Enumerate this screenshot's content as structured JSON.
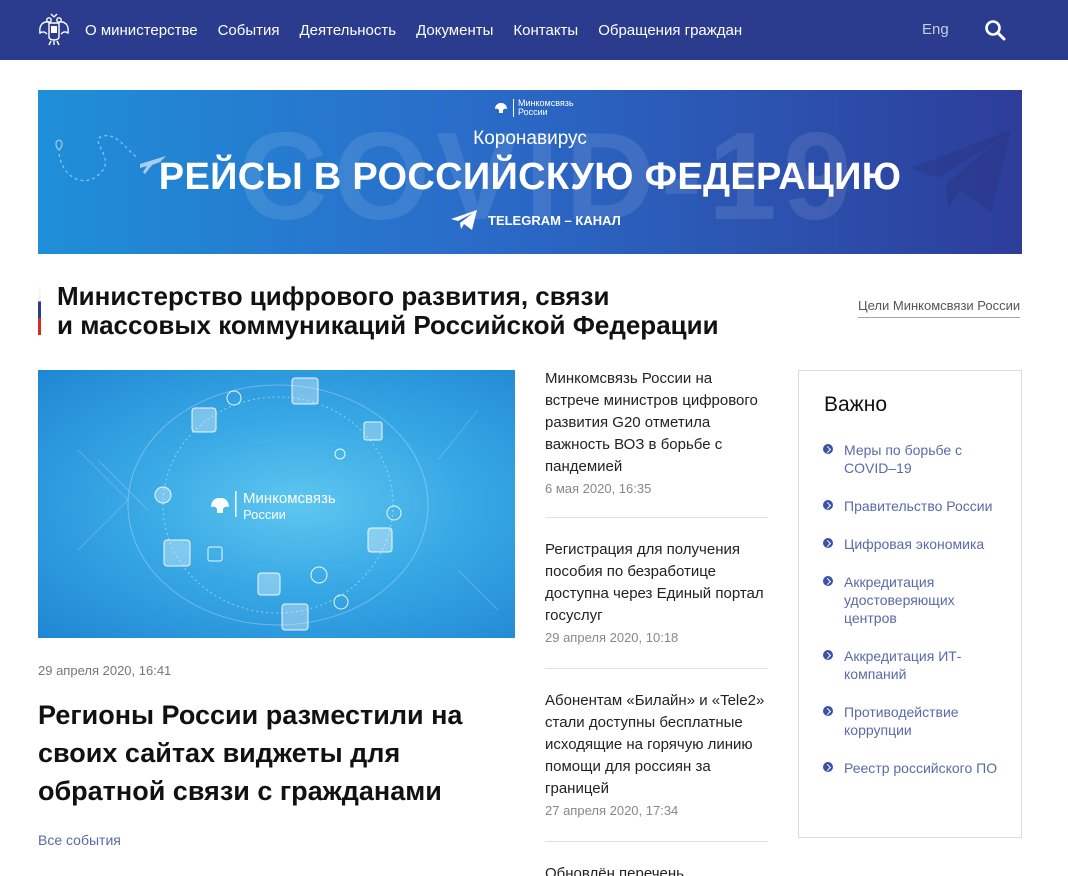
{
  "nav": {
    "items": [
      "О министерстве",
      "События",
      "Деятельность",
      "Документы",
      "Контакты",
      "Обращения граждан"
    ],
    "lang": "Eng"
  },
  "banner": {
    "logo_line1": "Минкомсвязь",
    "logo_line2": "России",
    "bg_text": "COVID-19",
    "kicker": "Коронавирус",
    "title": "РЕЙСЫ В РОССИЙСКУЮ ФЕДЕРАЦИЮ",
    "sub": "TELEGRAM – КАНАЛ"
  },
  "heading": {
    "title_line1": "Министерство цифрового развития, связи",
    "title_line2": "и массовых коммуникаций Российской Федерации",
    "goals_link": "Цели Минкомсвязи России"
  },
  "featured": {
    "logo_line1": "Минкомсвязь",
    "logo_line2": "России",
    "date": "29 апреля 2020, 16:41",
    "title": "Регионы России разместили на своих сайтах виджеты для обратной связи с гражданами",
    "all_events": "Все события"
  },
  "news": [
    {
      "title": "Минкомсвязь России на встрече министров цифрового развития G20 отметила важность ВОЗ в борьбе с пандемией",
      "date": "6 мая 2020, 16:35"
    },
    {
      "title": "Регистрация для получения пособия по безработице доступна через Единый портал госуслуг",
      "date": "29 апреля 2020, 10:18"
    },
    {
      "title": "Абонентам «Билайн» и «Tele2» стали доступны бесплатные исходящие на горячую линию помощи для россиян за границей",
      "date": "27 апреля 2020, 17:34"
    },
    {
      "title": "Обновлён перечень",
      "date": ""
    }
  ],
  "important": {
    "title": "Важно",
    "items": [
      "Меры по борьбе с COVID–19",
      "Правительство России",
      "Цифровая экономика",
      "Аккредитация удостоверяющих центров",
      "Аккредитация ИТ-компаний",
      "Противодействие коррупции",
      "Реестр российского ПО"
    ]
  },
  "colors": {
    "nav_bg": "#2b3c8e",
    "link": "#5a6aa8",
    "bullet": "#3d51a8"
  }
}
